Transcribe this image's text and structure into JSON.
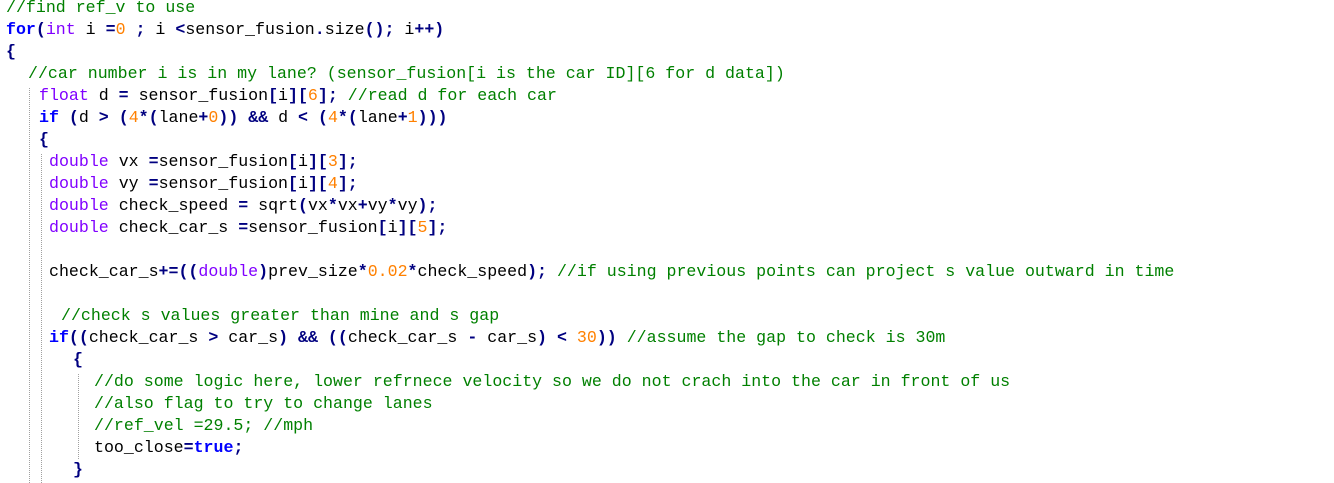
{
  "theme": {
    "background": "#ffffff",
    "comment": "#008000",
    "keyword": "#0000ff",
    "type": "#8000ff",
    "number": "#ff8000",
    "operator": "#000080",
    "text": "#000000",
    "guide": "#a0a0a0"
  },
  "code": {
    "lines": [
      [
        [
          "comment",
          "//find ref_v to use"
        ]
      ],
      [
        [
          "keyword",
          "for"
        ],
        [
          "operator",
          "("
        ],
        [
          "type",
          "int"
        ],
        [
          "text",
          " i "
        ],
        [
          "operator",
          "="
        ],
        [
          "number",
          "0"
        ],
        [
          "text",
          " "
        ],
        [
          "operator",
          ";"
        ],
        [
          "text",
          " i "
        ],
        [
          "operator",
          "<"
        ],
        [
          "text",
          "sensor_fusion"
        ],
        [
          "operator",
          "."
        ],
        [
          "text",
          "size"
        ],
        [
          "operator",
          "();"
        ],
        [
          "text",
          " i"
        ],
        [
          "operator",
          "++)"
        ]
      ],
      [
        [
          "operator",
          "{"
        ]
      ],
      [
        [
          "comment",
          "//car number i is in my lane? (sensor_fusion[i is the car ID][6 for d data])"
        ]
      ],
      [
        [
          "type",
          "float"
        ],
        [
          "text",
          " d "
        ],
        [
          "operator",
          "="
        ],
        [
          "text",
          " sensor_fusion"
        ],
        [
          "operator",
          "["
        ],
        [
          "text",
          "i"
        ],
        [
          "operator",
          "]["
        ],
        [
          "number",
          "6"
        ],
        [
          "operator",
          "];"
        ],
        [
          "text",
          " "
        ],
        [
          "comment",
          "//read d for each car"
        ]
      ],
      [
        [
          "keyword",
          "if"
        ],
        [
          "text",
          " "
        ],
        [
          "operator",
          "("
        ],
        [
          "text",
          "d "
        ],
        [
          "operator",
          ">"
        ],
        [
          "text",
          " "
        ],
        [
          "operator",
          "("
        ],
        [
          "number",
          "4"
        ],
        [
          "operator",
          "*("
        ],
        [
          "text",
          "lane"
        ],
        [
          "operator",
          "+"
        ],
        [
          "number",
          "0"
        ],
        [
          "operator",
          "))"
        ],
        [
          "text",
          " "
        ],
        [
          "operator",
          "&&"
        ],
        [
          "text",
          " d "
        ],
        [
          "operator",
          "<"
        ],
        [
          "text",
          " "
        ],
        [
          "operator",
          "("
        ],
        [
          "number",
          "4"
        ],
        [
          "operator",
          "*("
        ],
        [
          "text",
          "lane"
        ],
        [
          "operator",
          "+"
        ],
        [
          "number",
          "1"
        ],
        [
          "operator",
          ")))"
        ]
      ],
      [
        [
          "operator",
          "{"
        ]
      ],
      [
        [
          "type",
          "double"
        ],
        [
          "text",
          " vx "
        ],
        [
          "operator",
          "="
        ],
        [
          "text",
          "sensor_fusion"
        ],
        [
          "operator",
          "["
        ],
        [
          "text",
          "i"
        ],
        [
          "operator",
          "]["
        ],
        [
          "number",
          "3"
        ],
        [
          "operator",
          "];"
        ]
      ],
      [
        [
          "type",
          "double"
        ],
        [
          "text",
          " vy "
        ],
        [
          "operator",
          "="
        ],
        [
          "text",
          "sensor_fusion"
        ],
        [
          "operator",
          "["
        ],
        [
          "text",
          "i"
        ],
        [
          "operator",
          "]["
        ],
        [
          "number",
          "4"
        ],
        [
          "operator",
          "];"
        ]
      ],
      [
        [
          "type",
          "double"
        ],
        [
          "text",
          " check_speed "
        ],
        [
          "operator",
          "="
        ],
        [
          "text",
          " sqrt"
        ],
        [
          "operator",
          "("
        ],
        [
          "text",
          "vx"
        ],
        [
          "operator",
          "*"
        ],
        [
          "text",
          "vx"
        ],
        [
          "operator",
          "+"
        ],
        [
          "text",
          "vy"
        ],
        [
          "operator",
          "*"
        ],
        [
          "text",
          "vy"
        ],
        [
          "operator",
          ");"
        ]
      ],
      [
        [
          "type",
          "double"
        ],
        [
          "text",
          " check_car_s "
        ],
        [
          "operator",
          "="
        ],
        [
          "text",
          "sensor_fusion"
        ],
        [
          "operator",
          "["
        ],
        [
          "text",
          "i"
        ],
        [
          "operator",
          "]["
        ],
        [
          "number",
          "5"
        ],
        [
          "operator",
          "];"
        ]
      ],
      [],
      [
        [
          "text",
          "check_car_s"
        ],
        [
          "operator",
          "+=(("
        ],
        [
          "type",
          "double"
        ],
        [
          "operator",
          ")"
        ],
        [
          "text",
          "prev_size"
        ],
        [
          "operator",
          "*"
        ],
        [
          "number",
          "0.02"
        ],
        [
          "operator",
          "*"
        ],
        [
          "text",
          "check_speed"
        ],
        [
          "operator",
          ");"
        ],
        [
          "text",
          " "
        ],
        [
          "comment",
          "//if using previous points can project s value outward in time"
        ]
      ],
      [],
      [
        [
          "comment",
          "//check s values greater than mine and s gap"
        ]
      ],
      [
        [
          "keyword",
          "if"
        ],
        [
          "operator",
          "(("
        ],
        [
          "text",
          "check_car_s "
        ],
        [
          "operator",
          ">"
        ],
        [
          "text",
          " car_s"
        ],
        [
          "operator",
          ")"
        ],
        [
          "text",
          " "
        ],
        [
          "operator",
          "&&"
        ],
        [
          "text",
          " "
        ],
        [
          "operator",
          "(("
        ],
        [
          "text",
          "check_car_s "
        ],
        [
          "operator",
          "-"
        ],
        [
          "text",
          " car_s"
        ],
        [
          "operator",
          ")"
        ],
        [
          "text",
          " "
        ],
        [
          "operator",
          "<"
        ],
        [
          "text",
          " "
        ],
        [
          "number",
          "30"
        ],
        [
          "operator",
          "))"
        ],
        [
          "text",
          " "
        ],
        [
          "comment",
          "//assume the gap to check is 30m"
        ]
      ],
      [
        [
          "operator",
          "{"
        ]
      ],
      [
        [
          "comment",
          "//do some logic here, lower refrnece velocity so we do not crach into the car in front of us"
        ]
      ],
      [
        [
          "comment",
          "//also flag to try to change lanes"
        ]
      ],
      [
        [
          "comment",
          "//ref_vel =29.5; //mph"
        ]
      ],
      [
        [
          "text",
          "too_close"
        ],
        [
          "operator",
          "="
        ],
        [
          "keyword",
          "true"
        ],
        [
          "operator",
          ";"
        ]
      ],
      [
        [
          "operator",
          "}"
        ]
      ]
    ]
  }
}
